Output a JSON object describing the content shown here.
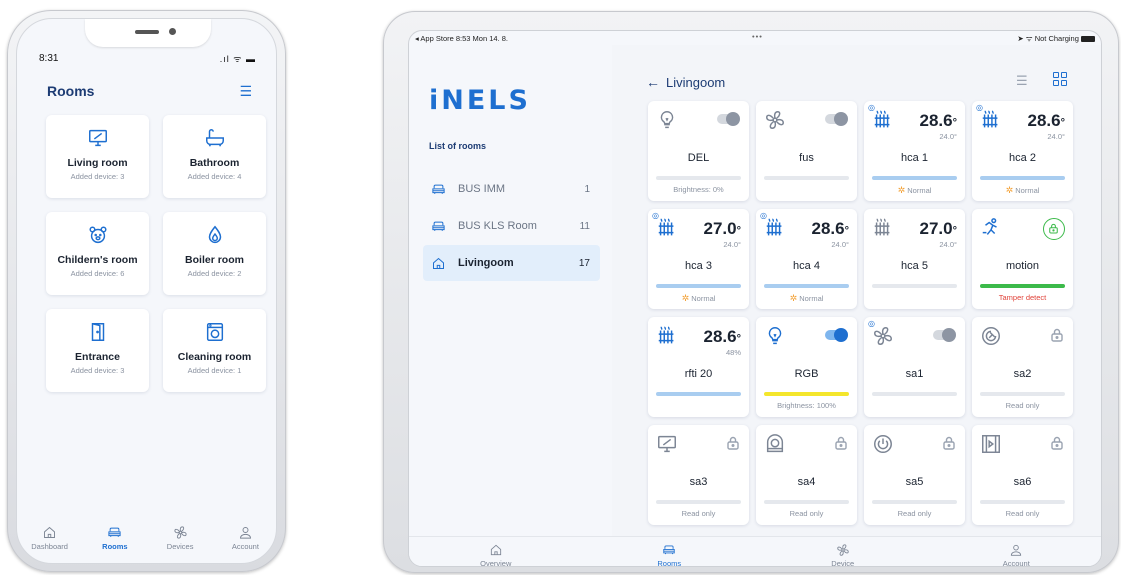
{
  "phone": {
    "status_time": "8:31",
    "status_icons": ".ıl ᯤ ▬",
    "title": "Rooms",
    "list_icon": "list-icon",
    "rooms": [
      {
        "icon": "monitor-icon",
        "name": "Living room",
        "sub": "Added device: 3"
      },
      {
        "icon": "bathtub-icon",
        "name": "Bathroom",
        "sub": "Added device: 4"
      },
      {
        "icon": "teddy-bear-icon",
        "name": "Childern's room",
        "sub": "Added device: 6"
      },
      {
        "icon": "flame-drop-icon",
        "name": "Boiler room",
        "sub": "Added device: 2"
      },
      {
        "icon": "door-icon",
        "name": "Entrance",
        "sub": "Added device: 3"
      },
      {
        "icon": "washing-machine-icon",
        "name": "Cleaning room",
        "sub": "Added device: 1"
      }
    ],
    "tabs": [
      {
        "icon": "home-icon",
        "label": "Dashboard",
        "active": false
      },
      {
        "icon": "sofa-icon",
        "label": "Rooms",
        "active": true
      },
      {
        "icon": "fan-icon",
        "label": "Devices",
        "active": false
      },
      {
        "icon": "user-icon",
        "label": "Account",
        "active": false
      }
    ]
  },
  "tablet": {
    "status_left": "◂ App Store  8:53  Mon 14. 8.",
    "status_center": "•••",
    "status_right": "➤ ᯤ Not Charging",
    "logo": "iNELS",
    "sidebar_heading": "List of rooms",
    "rooms": [
      {
        "icon": "sofa-icon",
        "label": "BUS IMM",
        "count": "1",
        "active": false
      },
      {
        "icon": "sofa-icon",
        "label": "BUS KLS Room",
        "count": "11",
        "active": false
      },
      {
        "icon": "home-icon",
        "label": "Livingoom",
        "count": "17",
        "active": true
      }
    ],
    "main_title": "Livingoom",
    "back_icon": "arrow-left-icon",
    "devices": [
      {
        "name": "DEL",
        "icon": "bulb-icon",
        "kind": "toggle",
        "on": false,
        "bar": "gray",
        "footer": "Brightness: 0%"
      },
      {
        "name": "fus",
        "icon": "fan-icon",
        "kind": "toggle",
        "on": false,
        "bar": "gray",
        "footer": ""
      },
      {
        "name": "hca 1",
        "icon": "radiator-icon",
        "kind": "temp",
        "value": "28.6",
        "unit": "°",
        "setpoint": "24.0°",
        "bar": "blue",
        "footer": "Normal",
        "wifi": true
      },
      {
        "name": "hca 2",
        "icon": "radiator-icon",
        "kind": "temp",
        "value": "28.6",
        "unit": "°",
        "setpoint": "24.0°",
        "bar": "blue",
        "footer": "Normal",
        "wifi": true
      },
      {
        "name": "hca 3",
        "icon": "radiator-icon",
        "kind": "temp",
        "value": "27.0",
        "unit": "°",
        "setpoint": "24.0°",
        "bar": "blue",
        "footer": "Normal",
        "wifi": true
      },
      {
        "name": "hca 4",
        "icon": "radiator-icon",
        "kind": "temp",
        "value": "28.6",
        "unit": "°",
        "setpoint": "24.0°",
        "bar": "blue",
        "footer": "Normal",
        "wifi": true
      },
      {
        "name": "hca 5",
        "icon": "radiator-icon",
        "kind": "temp",
        "value": "27.0",
        "unit": "°",
        "setpoint": "24.0°",
        "bar": "gray",
        "footer": "",
        "wifi": false,
        "gray": true
      },
      {
        "name": "motion",
        "icon": "running-person-icon",
        "kind": "lockgreen",
        "bar": "green",
        "footer": "Tamper detect",
        "footer_red": true
      },
      {
        "name": "rfti 20",
        "icon": "radiator-icon",
        "kind": "temp",
        "value": "28.6",
        "unit": "°",
        "setpoint": "48%",
        "bar": "blue",
        "footer": "",
        "wifi": false
      },
      {
        "name": "RGB",
        "icon": "bulb-icon",
        "kind": "toggle",
        "on": true,
        "bar": "yellow",
        "footer": "Brightness: 100%",
        "blue": true
      },
      {
        "name": "sa1",
        "icon": "fan-icon",
        "kind": "toggle",
        "on": false,
        "bar": "gray",
        "footer": "",
        "wifi": true
      },
      {
        "name": "sa2",
        "icon": "power-plug-icon",
        "kind": "lock",
        "bar": "gray",
        "footer": "Read only"
      },
      {
        "name": "sa3",
        "icon": "monitor-icon",
        "kind": "lock",
        "bar": "gray",
        "footer": "Read only"
      },
      {
        "name": "sa4",
        "icon": "dishwasher-icon",
        "kind": "lock",
        "bar": "gray",
        "footer": "Read only"
      },
      {
        "name": "sa5",
        "icon": "power-icon",
        "kind": "lock",
        "bar": "gray",
        "footer": "Read only"
      },
      {
        "name": "sa6",
        "icon": "shutter-icon",
        "kind": "lock",
        "bar": "gray",
        "footer": "Read only"
      }
    ],
    "tabs": [
      {
        "icon": "home-icon",
        "label": "Overview",
        "active": false
      },
      {
        "icon": "sofa-icon",
        "label": "Rooms",
        "active": true
      },
      {
        "icon": "fan-icon",
        "label": "Device",
        "active": false
      },
      {
        "icon": "user-icon",
        "label": "Account",
        "active": false
      }
    ]
  },
  "colors": {
    "accent": "#1e6fd0",
    "title": "#1d3c74",
    "green": "#3cba4a",
    "red": "#e0433a",
    "yellow": "#f4e62c"
  }
}
